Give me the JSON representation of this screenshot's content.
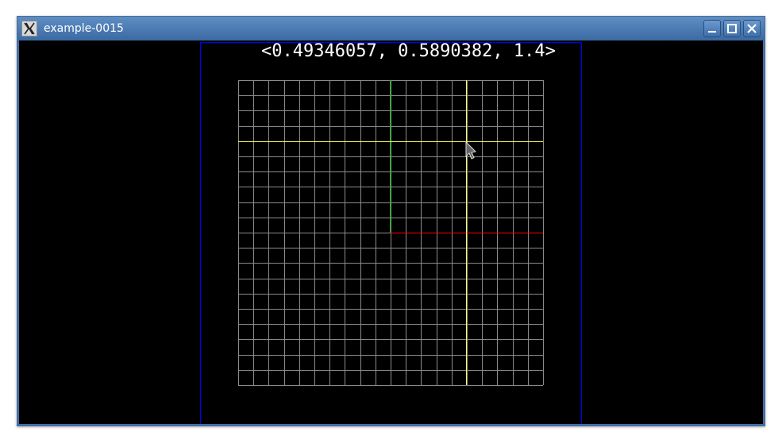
{
  "window": {
    "title": "example-0015",
    "app_icon": "x11-icon",
    "controls": {
      "minimize_icon": "minimize-icon",
      "maximize_icon": "maximize-icon",
      "close_icon": "close-icon"
    }
  },
  "viewport": {
    "coordinate_readout": "<0.49346057, 0.5890382, 1.4>",
    "background_color": "#000000",
    "frame_color": "#0000ff",
    "grid_color": "#8c8c8c",
    "x_axis_color": "#ff0000",
    "y_axis_color": "#00c000",
    "cursor_guide_color": "#ffff66",
    "cursor_icon": "arrow-cursor-icon"
  }
}
